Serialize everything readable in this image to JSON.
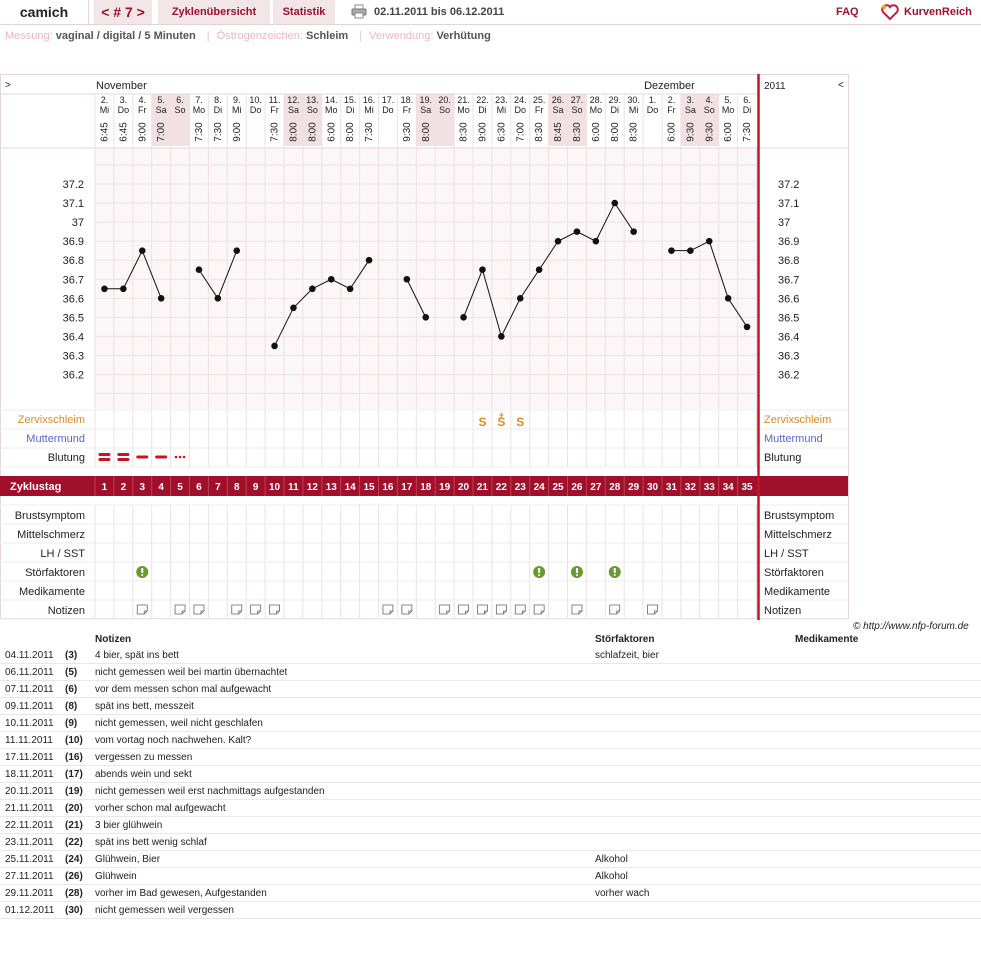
{
  "header": {
    "user": "camich",
    "cycle_nav": "< # 7 >",
    "tab_overview": "Zyklenübersicht",
    "tab_stats": "Statistik",
    "date_range": "02.11.2011 bis 06.12.2011",
    "faq": "FAQ",
    "logo": "KurvenReich"
  },
  "meta": {
    "measure_label": "Messung:",
    "measure_value": "vaginal / digital / 5 Minuten",
    "estrogen_label": "Östrogenzeichen:",
    "estrogen_value": "Schleim",
    "usage_label": "Verwendung:",
    "usage_value": "Verhütung"
  },
  "colors": {
    "accent": "#a0102a",
    "grid": "#f0e0e2",
    "weekend": "#f2e1e4",
    "cervix": "#e08a1e",
    "muttermund": "#5566cc",
    "stoer": "#6a9a2e"
  },
  "chart_data": {
    "type": "line",
    "title": "",
    "ylim": [
      36.2,
      37.2
    ],
    "yticks": [
      "37.2",
      "37.1",
      "37",
      "36.9",
      "36.8",
      "36.7",
      "36.6",
      "36.5",
      "36.4",
      "36.3",
      "36.2"
    ],
    "nav_left": ">",
    "nav_right": "<",
    "year": "2011",
    "month_labels": [
      {
        "day_index": 0,
        "label": "November"
      },
      {
        "day_index": 29,
        "label": "Dezember"
      }
    ],
    "days": [
      {
        "d": "2.",
        "wd": "Mi",
        "t": "6:45",
        "temp": 36.65
      },
      {
        "d": "3.",
        "wd": "Do",
        "t": "6:45",
        "temp": 36.65
      },
      {
        "d": "4.",
        "wd": "Fr",
        "t": "9:00",
        "temp": 36.85
      },
      {
        "d": "5.",
        "wd": "Sa",
        "t": "7:00",
        "temp": 36.6
      },
      {
        "d": "6.",
        "wd": "So",
        "t": "",
        "temp": null
      },
      {
        "d": "7.",
        "wd": "Mo",
        "t": "7:30",
        "temp": 36.75
      },
      {
        "d": "8.",
        "wd": "Di",
        "t": "7:30",
        "temp": 36.6
      },
      {
        "d": "9.",
        "wd": "Mi",
        "t": "9:00",
        "temp": 36.85
      },
      {
        "d": "10.",
        "wd": "Do",
        "t": "",
        "temp": null
      },
      {
        "d": "11.",
        "wd": "Fr",
        "t": "7:30",
        "temp": 36.35
      },
      {
        "d": "12.",
        "wd": "Sa",
        "t": "8:00",
        "temp": 36.55
      },
      {
        "d": "13.",
        "wd": "So",
        "t": "8:00",
        "temp": 36.65
      },
      {
        "d": "14.",
        "wd": "Mo",
        "t": "6:00",
        "temp": 36.7
      },
      {
        "d": "15.",
        "wd": "Di",
        "t": "8:00",
        "temp": 36.65
      },
      {
        "d": "16.",
        "wd": "Mi",
        "t": "7:30",
        "temp": 36.8
      },
      {
        "d": "17.",
        "wd": "Do",
        "t": "",
        "temp": null
      },
      {
        "d": "18.",
        "wd": "Fr",
        "t": "9:30",
        "temp": 36.7
      },
      {
        "d": "19.",
        "wd": "Sa",
        "t": "8:00",
        "temp": 36.5
      },
      {
        "d": "20.",
        "wd": "So",
        "t": "",
        "temp": null
      },
      {
        "d": "21.",
        "wd": "Mo",
        "t": "8:30",
        "temp": 36.5
      },
      {
        "d": "22.",
        "wd": "Di",
        "t": "9:00",
        "temp": 36.75
      },
      {
        "d": "23.",
        "wd": "Mi",
        "t": "6:30",
        "temp": 36.4
      },
      {
        "d": "24.",
        "wd": "Do",
        "t": "7:00",
        "temp": 36.6
      },
      {
        "d": "25.",
        "wd": "Fr",
        "t": "8:30",
        "temp": 36.75
      },
      {
        "d": "26.",
        "wd": "Sa",
        "t": "8:45",
        "temp": 36.9
      },
      {
        "d": "27.",
        "wd": "So",
        "t": "8:30",
        "temp": 36.95
      },
      {
        "d": "28.",
        "wd": "Mo",
        "t": "6:00",
        "temp": 36.9
      },
      {
        "d": "29.",
        "wd": "Di",
        "t": "8:00",
        "temp": 37.1
      },
      {
        "d": "30.",
        "wd": "Mi",
        "t": "8:30",
        "temp": 36.95
      },
      {
        "d": "1.",
        "wd": "Do",
        "t": "",
        "temp": null
      },
      {
        "d": "2.",
        "wd": "Fr",
        "t": "6:00",
        "temp": 36.85
      },
      {
        "d": "3.",
        "wd": "Sa",
        "t": "9:30",
        "temp": 36.85
      },
      {
        "d": "4.",
        "wd": "So",
        "t": "9:30",
        "temp": 36.9
      },
      {
        "d": "5.",
        "wd": "Mo",
        "t": "6:00",
        "temp": 36.6
      },
      {
        "d": "6.",
        "wd": "Di",
        "t": "7:30",
        "temp": 36.45
      }
    ],
    "weekend_indices": [
      3,
      4,
      10,
      11,
      17,
      18,
      24,
      25,
      31,
      32
    ],
    "cycle_label": "Zyklustag",
    "cycle_days": [
      "1",
      "2",
      "3",
      "4",
      "5",
      "6",
      "7",
      "8",
      "9",
      "10",
      "11",
      "12",
      "13",
      "14",
      "15",
      "16",
      "17",
      "18",
      "19",
      "20",
      "21",
      "22",
      "23",
      "24",
      "25",
      "26",
      "27",
      "28",
      "29",
      "30",
      "31",
      "32",
      "33",
      "34",
      "35"
    ],
    "rows_top": [
      "Zervixschleim",
      "Muttermund",
      "Blutung"
    ],
    "rows_bottom": [
      "Brustsymptom",
      "Mittelschmerz",
      "LH / SST",
      "Störfaktoren",
      "Medikamente",
      "Notizen"
    ],
    "cervix": [
      {
        "i": 20,
        "sym": "S"
      },
      {
        "i": 21,
        "sym": "S",
        "plus": "+"
      },
      {
        "i": 22,
        "sym": "S"
      }
    ],
    "bleeding": [
      {
        "i": 0,
        "level": "heavy"
      },
      {
        "i": 1,
        "level": "heavy"
      },
      {
        "i": 2,
        "level": "medium"
      },
      {
        "i": 3,
        "level": "medium"
      },
      {
        "i": 4,
        "level": "spotting"
      }
    ],
    "stoer_idx": [
      2,
      23,
      25,
      27
    ],
    "note_idx": [
      2,
      4,
      5,
      7,
      8,
      9,
      15,
      16,
      18,
      19,
      20,
      21,
      22,
      23,
      25,
      27,
      29
    ]
  },
  "copyright": "© http://www.nfp-forum.de",
  "notes_table": {
    "headers": [
      "Notizen",
      "Störfaktoren",
      "Medikamente"
    ],
    "rows": [
      [
        "04.11.2011",
        "(3)",
        "4 bier, spät ins bett",
        "schlafzeit, bier"
      ],
      [
        "06.11.2011",
        "(5)",
        "nicht gemessen weil bei martin übernachtet",
        ""
      ],
      [
        "07.11.2011",
        "(6)",
        "vor dem messen schon mal aufgewacht",
        ""
      ],
      [
        "09.11.2011",
        "(8)",
        "spät ins bett, messzeit",
        ""
      ],
      [
        "10.11.2011",
        "(9)",
        "nicht gemessen, weil nicht geschlafen",
        ""
      ],
      [
        "11.11.2011",
        "(10)",
        "vom vortag noch nachwehen. Kalt?",
        ""
      ],
      [
        "17.11.2011",
        "(16)",
        "vergessen zu messen",
        ""
      ],
      [
        "18.11.2011",
        "(17)",
        "abends wein und sekt",
        ""
      ],
      [
        "20.11.2011",
        "(19)",
        "nicht gemessen weil erst nachmittags aufgestanden",
        ""
      ],
      [
        "21.11.2011",
        "(20)",
        "vorher schon mal aufgewacht",
        ""
      ],
      [
        "22.11.2011",
        "(21)",
        "3 bier glühwein",
        ""
      ],
      [
        "23.11.2011",
        "(22)",
        "spät ins bett wenig schlaf",
        ""
      ],
      [
        "25.11.2011",
        "(24)",
        "Glühwein, Bier",
        "Alkohol"
      ],
      [
        "27.11.2011",
        "(26)",
        "Glühwein",
        "Alkohol"
      ],
      [
        "29.11.2011",
        "(28)",
        "vorher im Bad gewesen, Aufgestanden",
        "vorher wach"
      ],
      [
        "01.12.2011",
        "(30)",
        "nicht gemessen weil vergessen",
        ""
      ]
    ]
  }
}
